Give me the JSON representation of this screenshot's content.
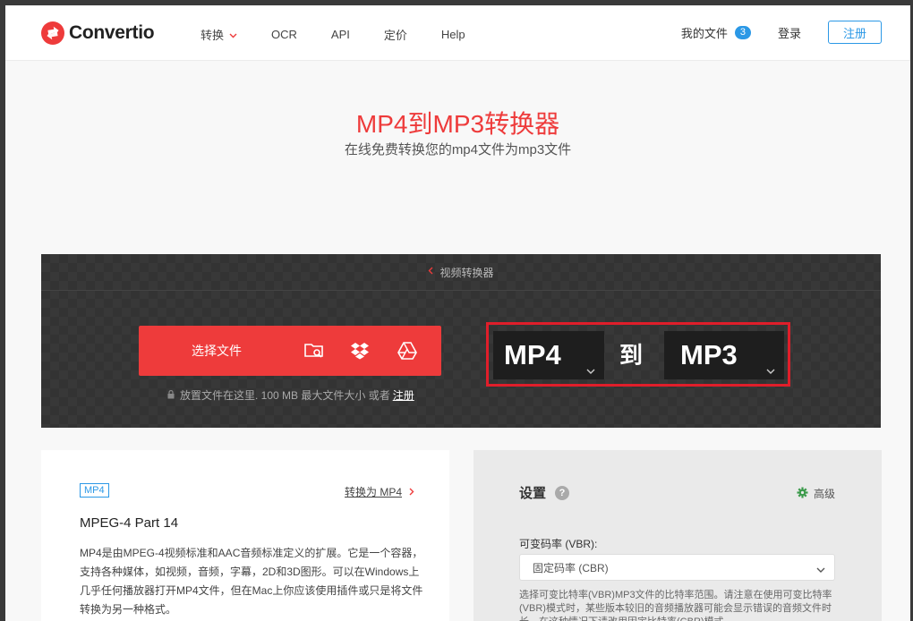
{
  "brand": {
    "name": "Convertio",
    "accent": "#ee3b3b",
    "link_blue": "#2b98e6"
  },
  "nav": {
    "items": [
      {
        "label": "转换"
      },
      {
        "label": "OCR"
      },
      {
        "label": "API"
      },
      {
        "label": "定价"
      },
      {
        "label": "Help"
      }
    ],
    "my_files_label": "我的文件",
    "my_files_count": "3",
    "login_label": "登录",
    "register_label": "注册"
  },
  "hero": {
    "title": "MP4到MP3转换器",
    "subtitle": "在线免费转换您的mp4文件为mp3文件"
  },
  "converter": {
    "breadcrumb": "视频转换器",
    "choose_files_label": "选择文件",
    "source_icons": [
      "folder-search-icon",
      "dropbox-icon",
      "google-drive-icon"
    ],
    "drop_note": "放置文件在这里. 100 MB 最大文件大小 或者",
    "drop_note_register": "注册",
    "from_format": "MP4",
    "to_word": "到",
    "to_format": "MP3"
  },
  "info": {
    "tag": "MP4",
    "convert_to_label": "转换为 MP4",
    "title": "MPEG-4 Part 14",
    "description": "MP4是由MPEG-4视频标准和AAC音频标准定义的扩展。它是一个容器，支持各种媒体，如视频，音频，字幕，2D和3D图形。可以在Windows上几乎任何播放器打开MP4文件，但在Mac上你应该使用插件或只是将文件转换为另一种格式。"
  },
  "settings": {
    "title": "设置",
    "help_icon_text": "?",
    "advanced_label": "高级",
    "vbr_label": "可变码率 (VBR):",
    "vbr_selected": "固定码率 (CBR)",
    "note": "选择可变比特率(VBR)MP3文件的比特率范围。请注意在使用可变比特率(VBR)模式时，某些版本较旧的音频播放器可能会显示错误的音频文件时长，在这种情况下请改用固定比特率(CBR)模式。"
  }
}
